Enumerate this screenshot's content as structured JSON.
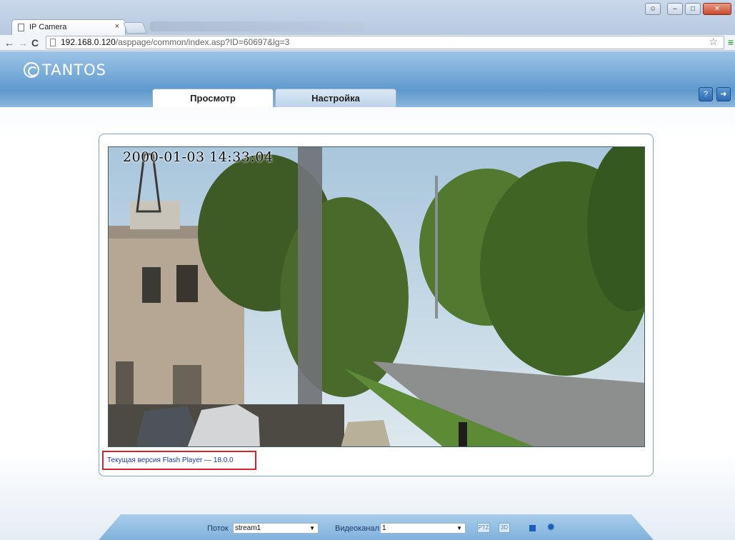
{
  "browser": {
    "tab_title": "IP Camera",
    "tab_close": "×",
    "url_host": "192.168.0.120",
    "url_path": "/asppage/common/index.asp?ID=60697&lg=3",
    "back_icon": "back-arrow-icon",
    "forward_icon": "forward-arrow-icon",
    "reload_icon": "reload-icon",
    "bookmark_icon": "star-icon"
  },
  "app": {
    "logo_text": "TANTOS",
    "tabs": [
      {
        "label": "Просмотр",
        "active": true
      },
      {
        "label": "Настройка",
        "active": false
      }
    ],
    "header_icons": [
      "help-icon",
      "logout-icon"
    ]
  },
  "video": {
    "osd_timestamp": "2000-01-03 14:33:04",
    "flash_note": "Текущая версия Flash Player — 18.0.0"
  },
  "controls": {
    "stream_label": "Поток",
    "stream_value": "stream1",
    "channel_label": "Видеоканал",
    "channel_value": "1",
    "ptz_label": "PTZ",
    "threed_label": "3D"
  },
  "colors": {
    "header_blue": "#76a9d8",
    "highlight_red": "#d8232a",
    "control_blue": "#1d5fb6"
  }
}
